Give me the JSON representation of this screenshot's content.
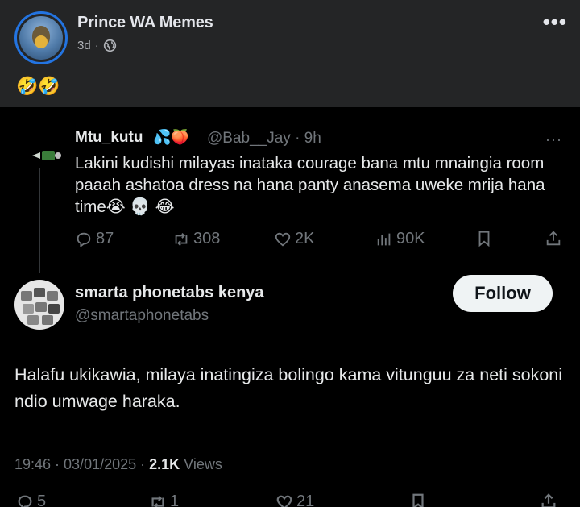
{
  "post": {
    "page_name": "Prince WA Memes",
    "time_ago": "3d",
    "separator": "·",
    "caption": "🤣🤣",
    "more_icon": "more-dots-icon"
  },
  "quoted_tweet": {
    "name": "Mtu_kutu",
    "name_emojis": "💦🍑",
    "handle_time": "@Bab__Jay · 9h",
    "more": "···",
    "text": "Lakini kudishi milayas inataka courage bana mtu mnaingia room paaah ashatoa dress na hana panty anasema uweke mrija hana  time😭 💀 😂",
    "replies": "87",
    "retweets": "308",
    "likes": "2K",
    "views": "90K"
  },
  "main_tweet": {
    "name": "smarta phonetabs kenya",
    "handle": "@smartaphonetabs",
    "follow_label": "Follow",
    "text": "Halafu ukikawia, milaya inatingiza bolingo kama vitunguu za neti sokoni ndio umwage haraka.",
    "timestamp": "19:46 · 03/01/2025 · ",
    "view_count": "2.1K",
    "views_label": " Views"
  },
  "bottom_actions": {
    "replies": "5",
    "retweets": "1",
    "likes": "21"
  },
  "colors": {
    "fb_background": "#242526",
    "tweet_background": "#000000",
    "muted_text": "#71767b",
    "follow_button": "#eff3f4",
    "avatar_ring": "#2374e1"
  }
}
